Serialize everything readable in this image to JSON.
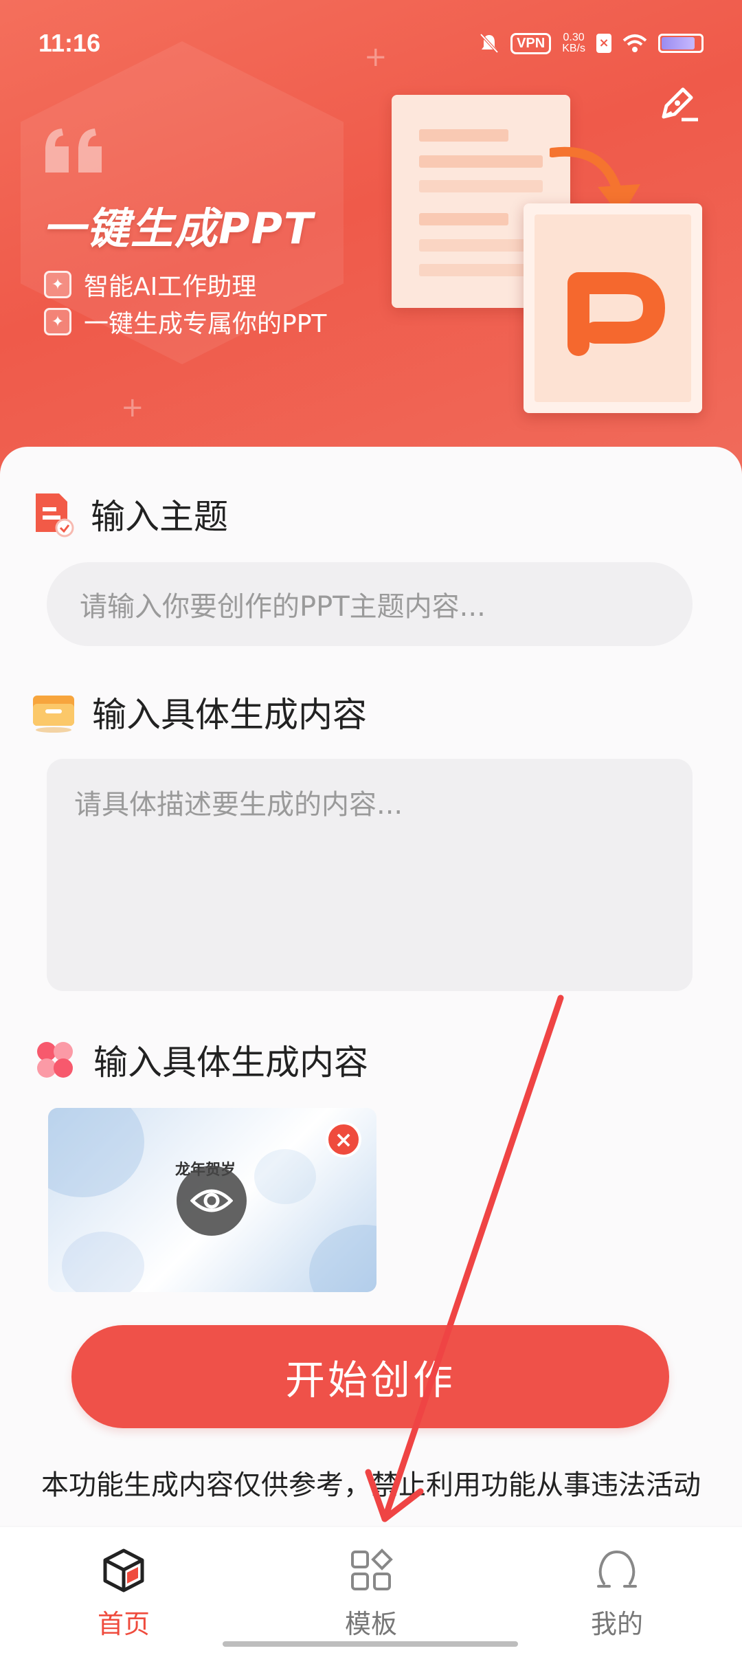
{
  "status_bar": {
    "time": "11:16",
    "vpn": "VPN",
    "speed_value": "0.30",
    "speed_unit": "KB/s"
  },
  "hero": {
    "title": "一键生成PPT",
    "features": [
      "智能AI工作助理",
      "一键生成专属你的PPT"
    ]
  },
  "topic": {
    "heading": "输入主题",
    "placeholder": "请输入你要创作的PPT主题内容..."
  },
  "content": {
    "heading": "输入具体生成内容",
    "placeholder": "请具体描述要生成的内容..."
  },
  "template": {
    "heading": "输入具体生成内容",
    "thumbnail_text": "龙年贺岁"
  },
  "cta": {
    "label": "开始创作"
  },
  "disclaimer": "本功能生成内容仅供参考，禁止利用功能从事违法活动",
  "nav": {
    "items": [
      {
        "label": "首页",
        "icon": "home-cube-icon",
        "active": true
      },
      {
        "label": "模板",
        "icon": "grid-icon",
        "active": false
      },
      {
        "label": "我的",
        "icon": "person-icon",
        "active": false
      }
    ]
  },
  "colors": {
    "accent": "#ef5149",
    "hero_start": "#f46f5c",
    "hero_end": "#ef5a4a",
    "annotation_arrow": "#ef4444"
  }
}
